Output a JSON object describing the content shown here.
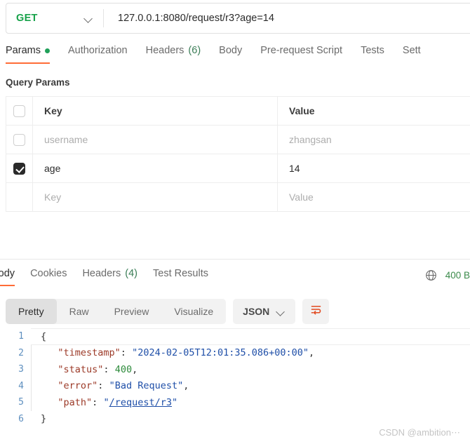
{
  "request": {
    "method": "GET",
    "method_color": "#17a24a",
    "url": "127.0.0.1:8080/request/r3?age=14",
    "tabs": [
      {
        "label": "Params",
        "badge": "",
        "dot": true,
        "active": true
      },
      {
        "label": "Authorization",
        "badge": "",
        "dot": false,
        "active": false
      },
      {
        "label": "Headers",
        "badge": "(6)",
        "dot": false,
        "active": false
      },
      {
        "label": "Body",
        "badge": "",
        "dot": false,
        "active": false
      },
      {
        "label": "Pre-request Script",
        "badge": "",
        "dot": false,
        "active": false
      },
      {
        "label": "Tests",
        "badge": "",
        "dot": false,
        "active": false
      },
      {
        "label": "Sett",
        "badge": "",
        "dot": false,
        "active": false
      }
    ]
  },
  "query_params": {
    "section_label": "Query Params",
    "columns": {
      "key": "Key",
      "value": "Value"
    },
    "rows": [
      {
        "checked": false,
        "key": "username",
        "value": "zhangsan",
        "muted": true
      },
      {
        "checked": true,
        "key": "age",
        "value": "14",
        "muted": false
      },
      {
        "checked": null,
        "key": "Key",
        "value": "Value",
        "muted": true
      }
    ]
  },
  "response": {
    "tabs": [
      {
        "label": "Body",
        "badge": "",
        "active": true
      },
      {
        "label": "Cookies",
        "badge": "",
        "active": false
      },
      {
        "label": "Headers",
        "badge": "(4)",
        "active": false
      },
      {
        "label": "Test Results",
        "badge": "",
        "active": false
      }
    ],
    "status_text": "400 B",
    "status_color": "#3a8a4a",
    "globe_icon": "globe-icon",
    "view_modes": [
      "Pretty",
      "Raw",
      "Preview",
      "Visualize"
    ],
    "active_view": "Pretty",
    "format": "JSON",
    "wrap_icon": "wrap-lines-icon",
    "accent_color": "#ff6c37",
    "body_lines": [
      {
        "num": "1",
        "indent": false,
        "tokens": [
          {
            "t": "{",
            "c": "p"
          }
        ]
      },
      {
        "num": "2",
        "indent": true,
        "tokens": [
          {
            "t": "\"timestamp\"",
            "c": "k"
          },
          {
            "t": ": ",
            "c": "p"
          },
          {
            "t": "\"2024-02-05T12:01:35.086+00:00\"",
            "c": "s"
          },
          {
            "t": ",",
            "c": "p"
          }
        ]
      },
      {
        "num": "3",
        "indent": true,
        "tokens": [
          {
            "t": "\"status\"",
            "c": "k"
          },
          {
            "t": ": ",
            "c": "p"
          },
          {
            "t": "400",
            "c": "n"
          },
          {
            "t": ",",
            "c": "p"
          }
        ]
      },
      {
        "num": "4",
        "indent": true,
        "tokens": [
          {
            "t": "\"error\"",
            "c": "k"
          },
          {
            "t": ": ",
            "c": "p"
          },
          {
            "t": "\"Bad Request\"",
            "c": "s"
          },
          {
            "t": ",",
            "c": "p"
          }
        ]
      },
      {
        "num": "5",
        "indent": true,
        "tokens": [
          {
            "t": "\"path\"",
            "c": "k"
          },
          {
            "t": ": ",
            "c": "p"
          },
          {
            "t": "\"",
            "c": "s"
          },
          {
            "t": "/request/r3",
            "c": "lnk"
          },
          {
            "t": "\"",
            "c": "s"
          }
        ]
      },
      {
        "num": "6",
        "indent": false,
        "tokens": [
          {
            "t": "}",
            "c": "p"
          }
        ]
      }
    ]
  },
  "watermark": "CSDN @ambition⋯"
}
